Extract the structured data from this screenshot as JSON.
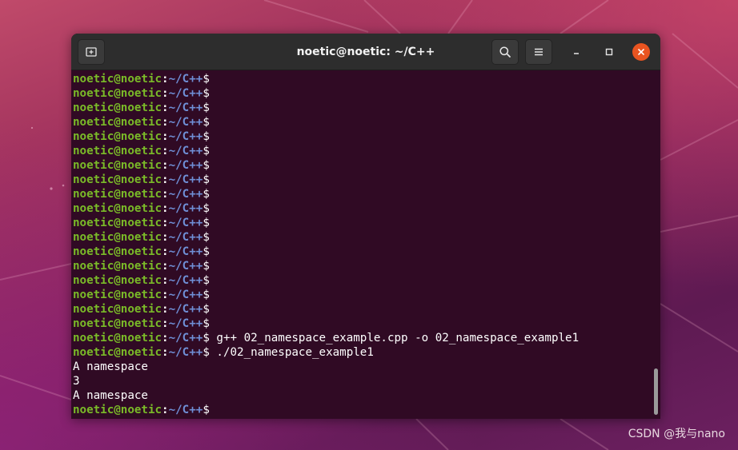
{
  "window": {
    "title": "noetic@noetic: ~/C++"
  },
  "prompt": {
    "user_host": "noetic@noetic",
    "colon": ":",
    "path": "~/C++",
    "dollar": "$"
  },
  "terminal_lines": [
    {
      "kind": "prompt",
      "command": ""
    },
    {
      "kind": "prompt",
      "command": ""
    },
    {
      "kind": "prompt",
      "command": ""
    },
    {
      "kind": "prompt",
      "command": ""
    },
    {
      "kind": "prompt",
      "command": ""
    },
    {
      "kind": "prompt",
      "command": ""
    },
    {
      "kind": "prompt",
      "command": ""
    },
    {
      "kind": "prompt",
      "command": ""
    },
    {
      "kind": "prompt",
      "command": ""
    },
    {
      "kind": "prompt",
      "command": ""
    },
    {
      "kind": "prompt",
      "command": ""
    },
    {
      "kind": "prompt",
      "command": ""
    },
    {
      "kind": "prompt",
      "command": ""
    },
    {
      "kind": "prompt",
      "command": ""
    },
    {
      "kind": "prompt",
      "command": ""
    },
    {
      "kind": "prompt",
      "command": ""
    },
    {
      "kind": "prompt",
      "command": ""
    },
    {
      "kind": "prompt",
      "command": ""
    },
    {
      "kind": "prompt",
      "command": " g++ 02_namespace_example.cpp -o 02_namespace_example1"
    },
    {
      "kind": "prompt",
      "command": " ./02_namespace_example1"
    },
    {
      "kind": "output",
      "text": "A namespace"
    },
    {
      "kind": "output",
      "text": "3"
    },
    {
      "kind": "output",
      "text": "A namespace"
    },
    {
      "kind": "prompt",
      "command": ""
    }
  ],
  "icons": {
    "new_tab": "new-tab-icon",
    "search": "search-icon",
    "menu": "hamburger-menu-icon",
    "minimize": "minimize-icon",
    "maximize": "maximize-icon",
    "close": "close-icon"
  },
  "colors": {
    "terminal_bg": "#300a24",
    "prompt_user": "#7aba28",
    "prompt_path": "#6f8fd6",
    "close_button": "#e95420"
  },
  "watermark": "CSDN @我与nano"
}
